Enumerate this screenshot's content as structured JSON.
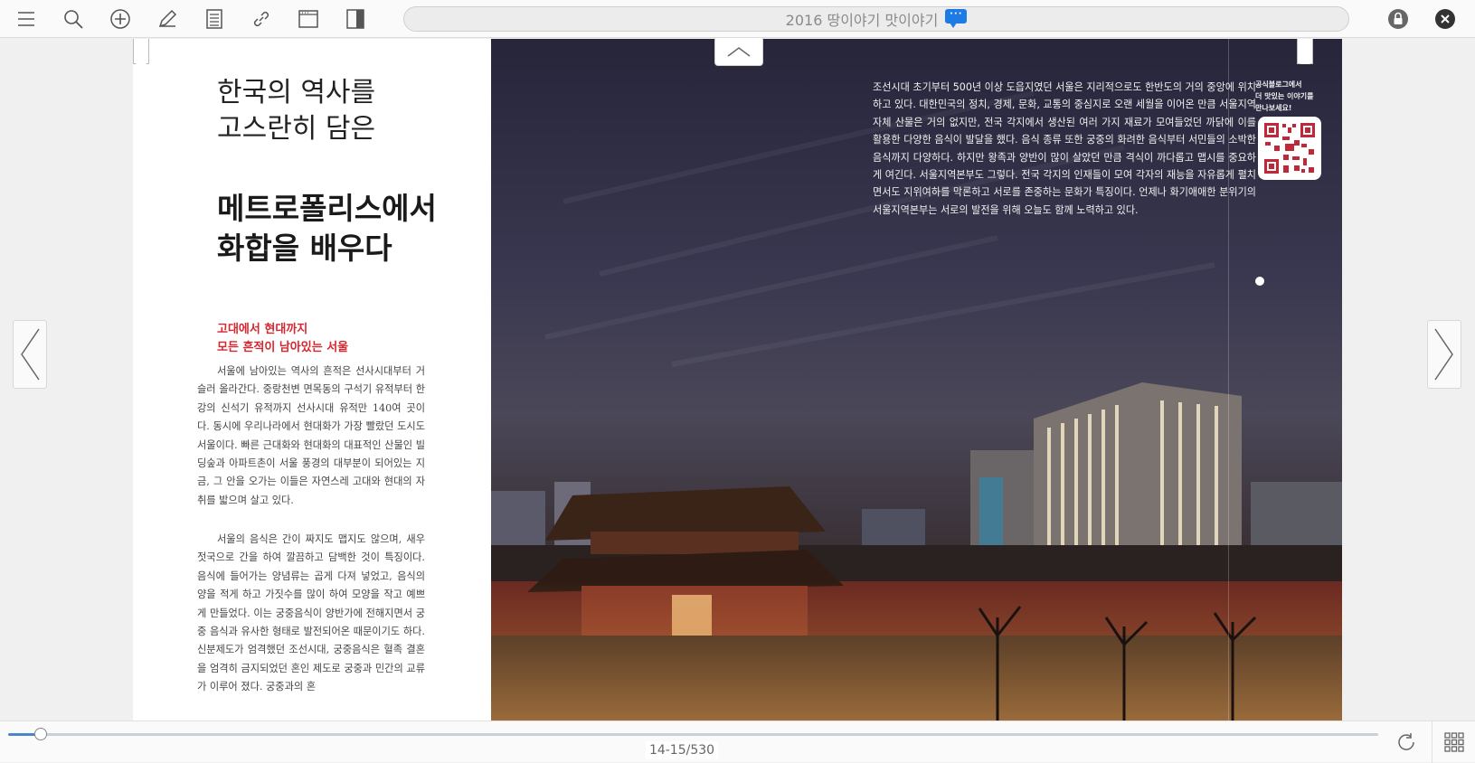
{
  "toolbar": {
    "title": "2016 땅이야기 맛이야기",
    "comment_badge": "···",
    "icons": [
      "menu-icon",
      "search-icon",
      "add-icon",
      "pencil-icon",
      "note-icon",
      "link-icon",
      "screen-icon",
      "sidebar-icon"
    ],
    "right_icons": [
      "lock-icon",
      "close-icon"
    ]
  },
  "left_page": {
    "title_line": "한국의 역사를\n고스란히 담은",
    "headline": "메트로폴리스에서\n화합을 배우다",
    "subheading": "고대에서 현대까지\n모든 흔적이 남아있는 서울",
    "paragraph1": "서울에 남아있는 역사의 흔적은 선사시대부터 거슬러 올라간다. 중랑천변 면목동의 구석기 유적부터 한강의 신석기 유적까지 선사시대 유적만 140여 곳이다. 동시에 우리나라에서 현대화가 가장 빨랐던 도시도 서울이다. 빠른 근대화와 현대화의 대표적인 산물인 빌딩숲과 아파트촌이 서울 풍경의 대부분이 되어있는 지금, 그 안을 오가는 이들은 자연스레 고대와 현대의 자취를 밟으며 살고 있다.",
    "paragraph2": "서울의 음식은 간이 짜지도 맵지도 않으며, 새우젓국으로 간을 하여 깔끔하고 담백한 것이 특징이다. 음식에 들어가는 양념류는 곱게 다져 넣었고, 음식의 양을 적게 하고 가짓수를 많이 하여 모양을 작고 예쁘게 만들었다. 이는 궁중음식이 양반가에 전해지면서 궁중 음식과 유사한 형태로 발전되어온 때문이기도 하다. 신분제도가 엄격했던 조선시대, 궁중음식은 혈족 결혼을 엄격히 금지되었던 혼인 제도로 궁중과 민간의 교류가 이루어 졌다. 궁중과의 혼"
  },
  "right_page": {
    "body": "조선시대 초기부터 500년 이상 도읍지였던 서울은 지리적으로도 한반도의 거의 중앙에 위치하고 있다. 대한민국의 정치, 경제, 문화, 교통의 중심지로 오랜 세월을 이어온 만큼 서울지역 자체 산물은 거의 없지만, 전국 각지에서 생산된 여러 가지 재료가 모여들었던 까닭에 이를 활용한 다양한 음식이 발달을 했다. 음식 종류 또한 궁중의 화려한 음식부터 서민들의 소박한 음식까지 다양하다. 하지만 왕족과 양반이 많이 살았던 만큼 격식이 까다롭고 맵시를 중요하게 여긴다. 서울지역본부도 그렇다. 전국 각지의 인재들이 모여 각자의 재능을 자유롭게 펼치면서도  지위여하를 막론하고 서로를 존중하는 문화가 특징이다. 언제나 화기애애한 분위기의 서울지역본부는 서로의 발전을 위해 오늘도 함께 노력하고 있다.",
    "qr_caption": "공식블로그에서\n더 맛있는 이야기를\n만나보세요!"
  },
  "bottom": {
    "page_label": "14-15/530",
    "progress": 0.024
  },
  "colors": {
    "accent_red": "#d7262e",
    "slider_blue": "#4b86c8",
    "badge_blue": "#1e7be6"
  }
}
